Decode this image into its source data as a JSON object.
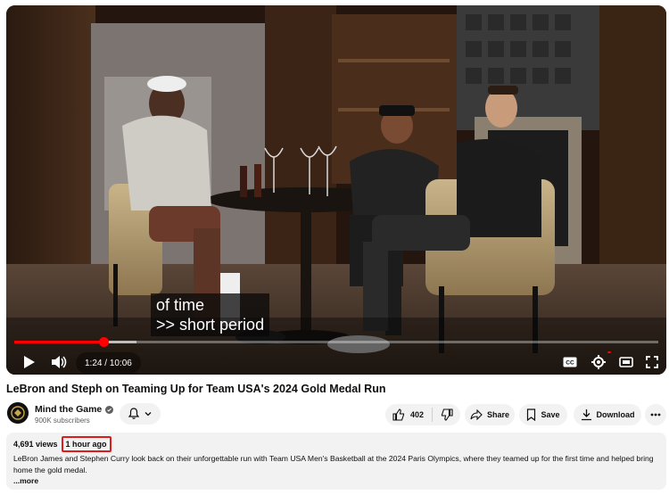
{
  "player": {
    "subtitle_lines": [
      "of time",
      ">> short period"
    ],
    "time": {
      "current": "1:24",
      "separator": " / ",
      "duration": "10:06"
    },
    "progress_fraction": 0.139,
    "buffered_fraction": 0.19,
    "accent_color": "#ff0000",
    "icons": [
      "play-icon",
      "volume-icon",
      "closed-captions-icon",
      "settings-icon",
      "theater-mode-icon",
      "fullscreen-icon"
    ]
  },
  "video": {
    "title": "LeBron and Steph on Teaming Up for Team USA's 2024 Gold Medal Run"
  },
  "channel": {
    "name": "Mind the Game",
    "subscribers": "900K subscribers",
    "verified": true
  },
  "actions": {
    "like_count": "402",
    "share_label": "Share",
    "save_label": "Save",
    "download_label": "Download"
  },
  "description": {
    "views": "4,691 views",
    "posted": "1 hour ago",
    "text": "LeBron James and Stephen Curry look back on their unforgettable run with Team USA Men's Basketball at the 2024 Paris Olympics, where they teamed up for the first time and helped bring home the gold medal.",
    "more_label": "...more",
    "highlight_color": "#e01b1b"
  }
}
